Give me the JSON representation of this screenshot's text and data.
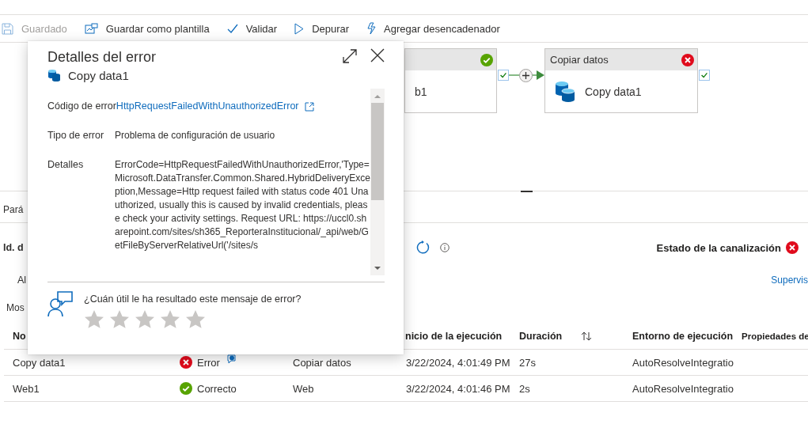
{
  "toolbar": [
    {
      "label": "Guardado",
      "disabled": true
    },
    {
      "label": "Guardar como plantilla",
      "disabled": false
    },
    {
      "label": "Validar",
      "disabled": false
    },
    {
      "label": "Depurar",
      "disabled": false
    },
    {
      "label": "Agregar desencadenador",
      "disabled": false
    }
  ],
  "canvas": {
    "nodes": [
      {
        "kind": "web",
        "name": "b1",
        "succeeded": true
      },
      {
        "kind": "copy",
        "title": "Copiar datos",
        "name": "Copy data1",
        "succeeded": false
      }
    ]
  },
  "panel": {
    "tab": "Pará",
    "run_id_label": "Id. d",
    "pipeline_status": {
      "label": "Estado de la canalización",
      "succeeded": false
    },
    "filter": "Al",
    "monitor_link": "Supervis",
    "showing": "Mos",
    "table": {
      "columns": [
        {
          "label": "No",
          "kind": "plain"
        },
        {
          "label": "nicio de la ejecución",
          "kind": "plain"
        },
        {
          "label": "Duración",
          "kind": "sortable"
        },
        {
          "label": "Entorno de ejecución",
          "kind": "plain"
        },
        {
          "label": "Propiedades de",
          "kind": "plain"
        }
      ],
      "rows": [
        {
          "name": "Copy data1",
          "status": {
            "label": "Error",
            "succeeded": false,
            "feedback": true
          },
          "activity": "Copiar datos",
          "start": "3/22/2024, 4:01:49 PM",
          "duration": "27s",
          "runtime": "AutoResolveIntegratio"
        },
        {
          "name": "Web1",
          "status": {
            "label": "Correcto",
            "succeeded": true,
            "feedback": false
          },
          "activity": "Web",
          "start": "3/22/2024, 4:01:46 PM",
          "duration": "2s",
          "runtime": "AutoResolveIntegratio"
        }
      ]
    }
  },
  "dialog": {
    "title": "Detalles del error",
    "subtitle": "Copy data1",
    "fields": [
      {
        "kind": "link",
        "label": "Código de error",
        "value": "HttpRequestFailedWithUnauthorizedError"
      },
      {
        "kind": "text",
        "label": "Tipo de error",
        "value": "Problema de configuración de usuario"
      },
      {
        "kind": "text",
        "label": "Detalles",
        "value": "ErrorCode=HttpRequestFailedWithUnauthorizedError,'Type=Microsoft.DataTransfer.Common.Shared.HybridDeliveryException,Message=Http request failed with status code 401 Unauthorized, usually this is caused by invalid credentials, please check your activity settings. Request URL: https://uccl0.sharepoint.com/sites/sh365_ReporteraInstitucional/_api/web/GetFileByServerRelativeUrl('/sites/s"
      }
    ],
    "feedback": {
      "question": "¿Cuán útil le ha resultado este mensaje de error?",
      "stars": 0
    }
  }
}
